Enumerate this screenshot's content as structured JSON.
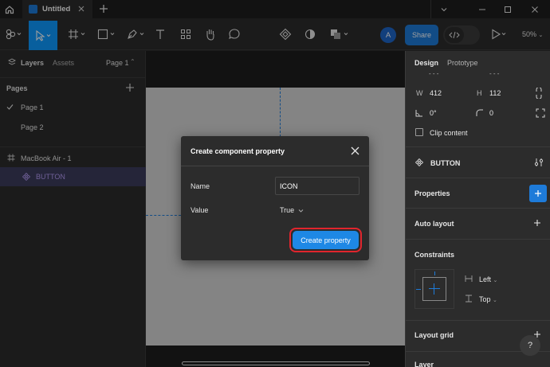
{
  "titlebar": {
    "tab_title": "Untitled"
  },
  "toolbar": {
    "avatar_initial": "A",
    "share_label": "Share",
    "zoom": "50%"
  },
  "left_panel": {
    "tab_layers": "Layers",
    "tab_assets": "Assets",
    "page_selector": "Page 1",
    "pages_header": "Pages",
    "pages": [
      {
        "label": "Page 1",
        "checked": true
      },
      {
        "label": "Page 2",
        "checked": false
      }
    ],
    "frame_name": "MacBook Air - 1",
    "component_name": "BUTTON"
  },
  "dialog": {
    "title": "Create component property",
    "name_label": "Name",
    "name_value": "ICON",
    "value_label": "Value",
    "value_selected": "True",
    "create_label": "Create property"
  },
  "right_panel": {
    "tab_design": "Design",
    "tab_prototype": "Prototype",
    "x_label": "- - -",
    "y_label": "- - -",
    "w_label": "W",
    "w_value": "412",
    "h_label": "H",
    "h_value": "112",
    "rotation": "0°",
    "radius": "0",
    "clip_content": "Clip content",
    "component_name": "BUTTON",
    "properties": "Properties",
    "auto_layout": "Auto layout",
    "constraints": "Constraints",
    "constraint_h": "Left",
    "constraint_v": "Top",
    "layout_grid": "Layout grid",
    "layer": "Layer",
    "help": "?"
  },
  "colors": {
    "accent": "#0d99ff",
    "highlight_ring": "#e1252d",
    "panel_bg": "#2c2c2c"
  }
}
